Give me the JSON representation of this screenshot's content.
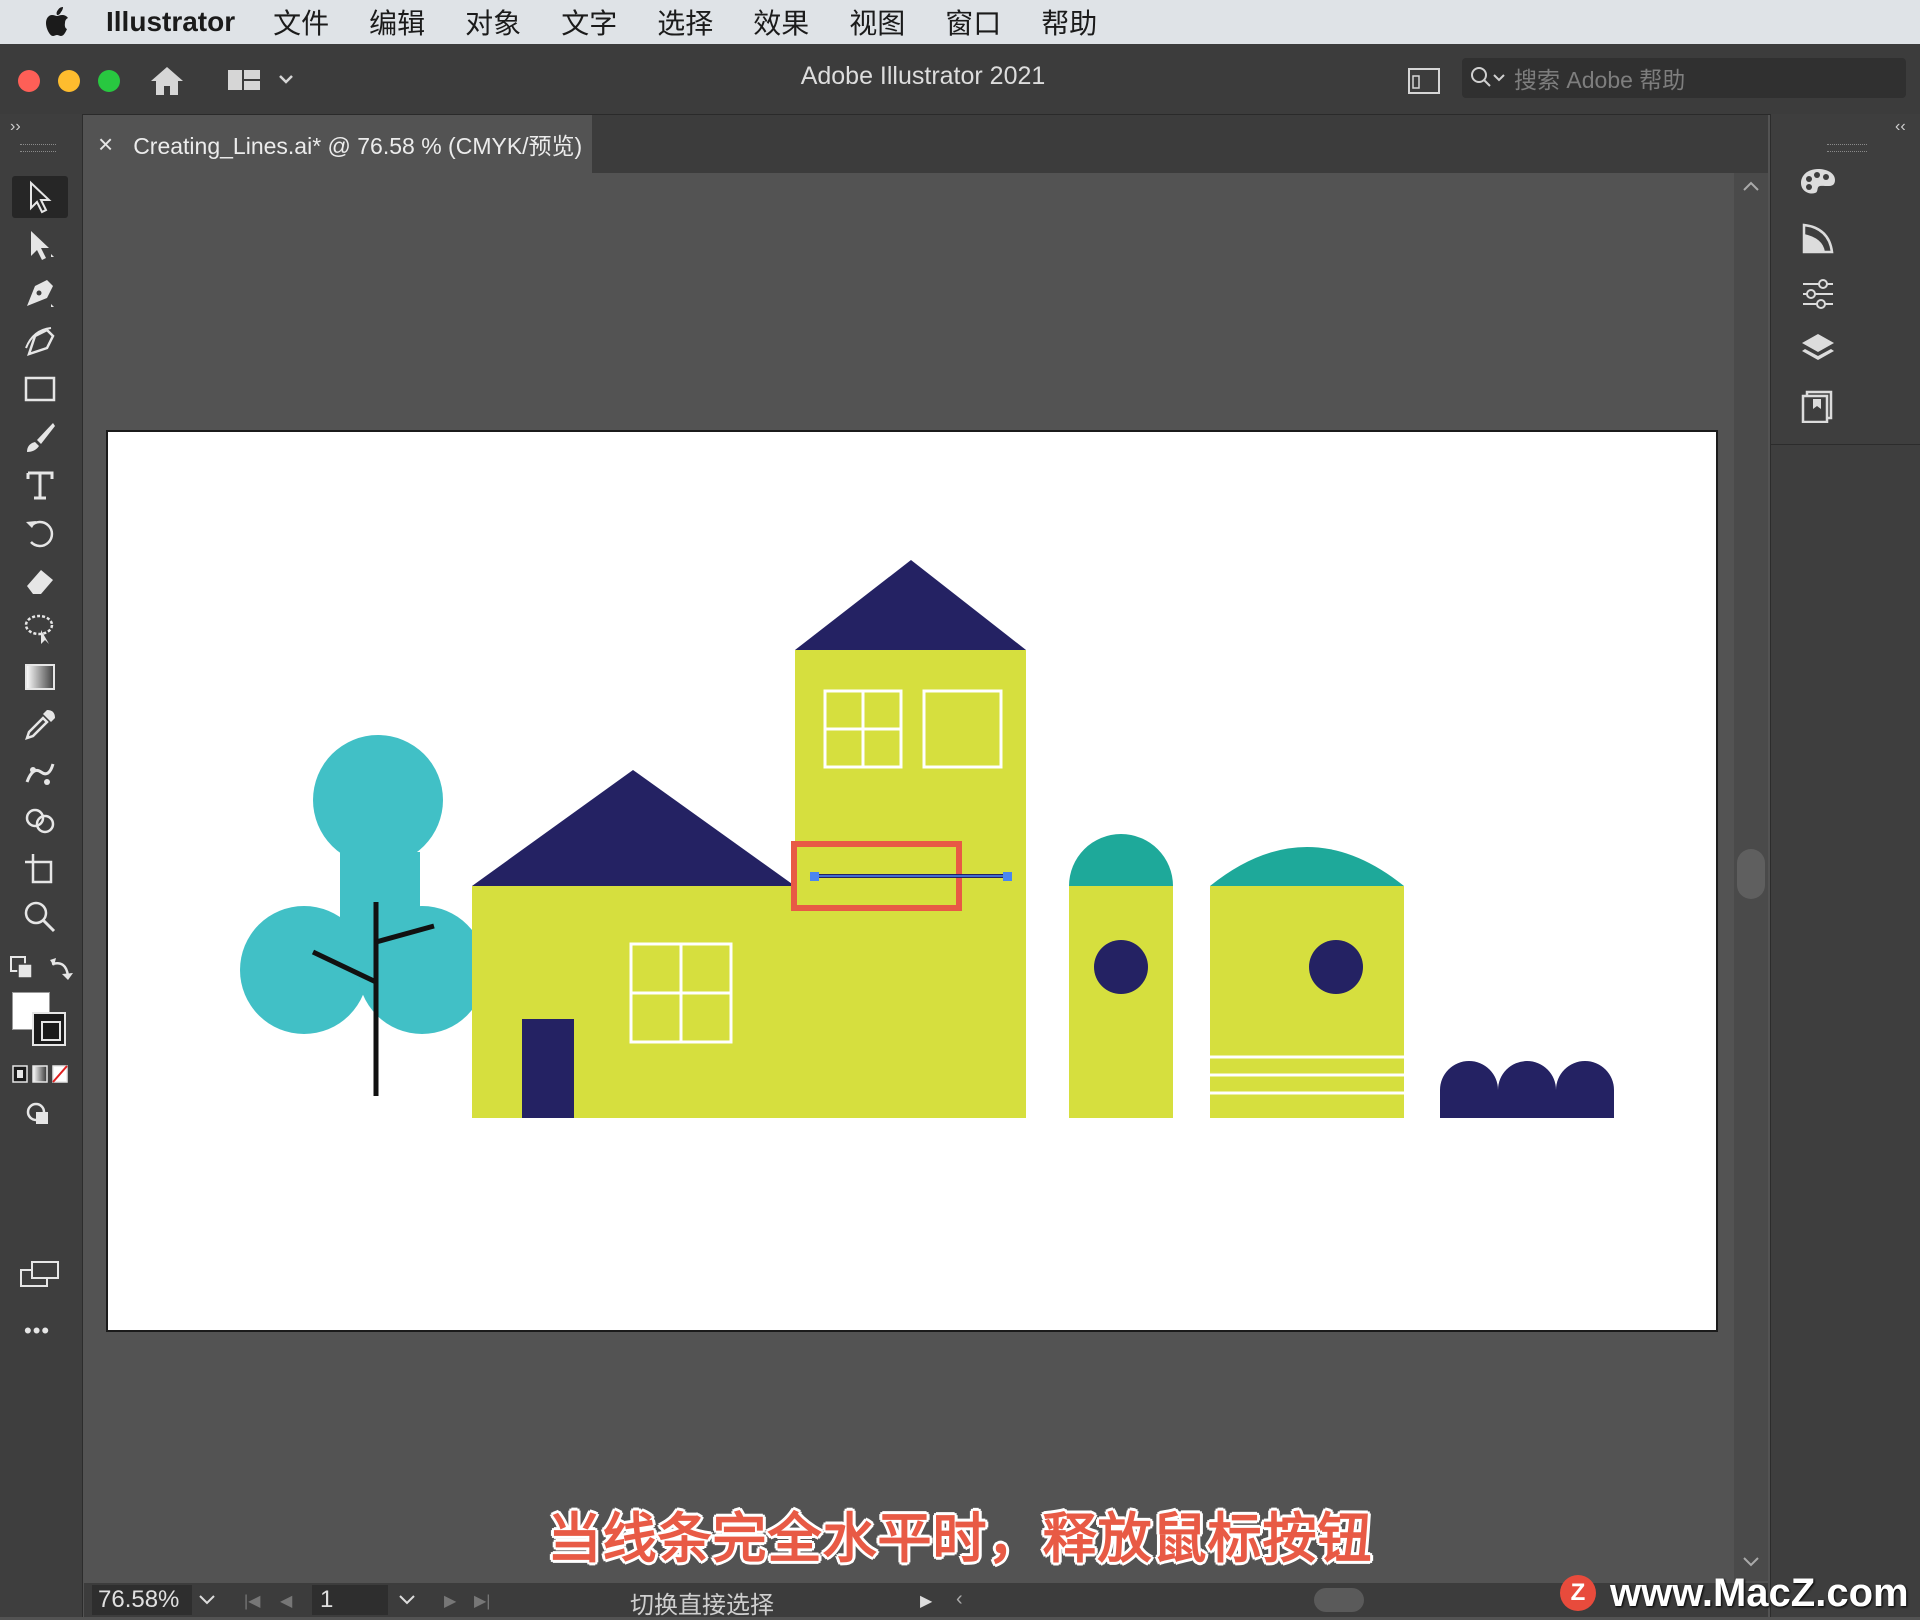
{
  "menubar": {
    "app_name": "Illustrator",
    "items": [
      "文件",
      "编辑",
      "对象",
      "文字",
      "选择",
      "效果",
      "视图",
      "窗口",
      "帮助"
    ]
  },
  "window": {
    "title": "Adobe Illustrator 2021",
    "search_placeholder": "搜索 Adobe 帮助"
  },
  "document_tab": {
    "close": "×",
    "title": "Creating_Lines.ai* @ 76.58 % (CMYK/预览)"
  },
  "status_bar": {
    "zoom": "76.58%",
    "page": "1",
    "status_text": "切换直接选择"
  },
  "caption": "当线条完全水平时，释放鼠标按钮",
  "watermark": {
    "logo_letter": "Z",
    "text": "www.MacZ.com"
  },
  "colors": {
    "house_yellow": "#d6df3e",
    "roof_navy": "#242263",
    "tree_teal": "#41c0c6",
    "dome_teal": "#1ea99a",
    "highlight_red": "#e85a45",
    "anchor_blue": "#4a86f0"
  },
  "toolbar": {
    "tools": [
      "selection-tool",
      "direct-selection-tool",
      "pen-tool",
      "curvature-tool",
      "rectangle-tool",
      "paintbrush-tool",
      "type-tool",
      "rotate-tool",
      "eraser-tool",
      "lasso-tool",
      "gradient-tool",
      "eyedropper-tool",
      "puppet-warp-tool",
      "shape-builder-tool",
      "artboard-tool",
      "zoom-tool"
    ],
    "more_label": "•••"
  },
  "right_panel": {
    "icons": [
      "color-palette-icon",
      "graphic-style-icon",
      "properties-icon",
      "layers-icon",
      "libraries-icon"
    ]
  }
}
